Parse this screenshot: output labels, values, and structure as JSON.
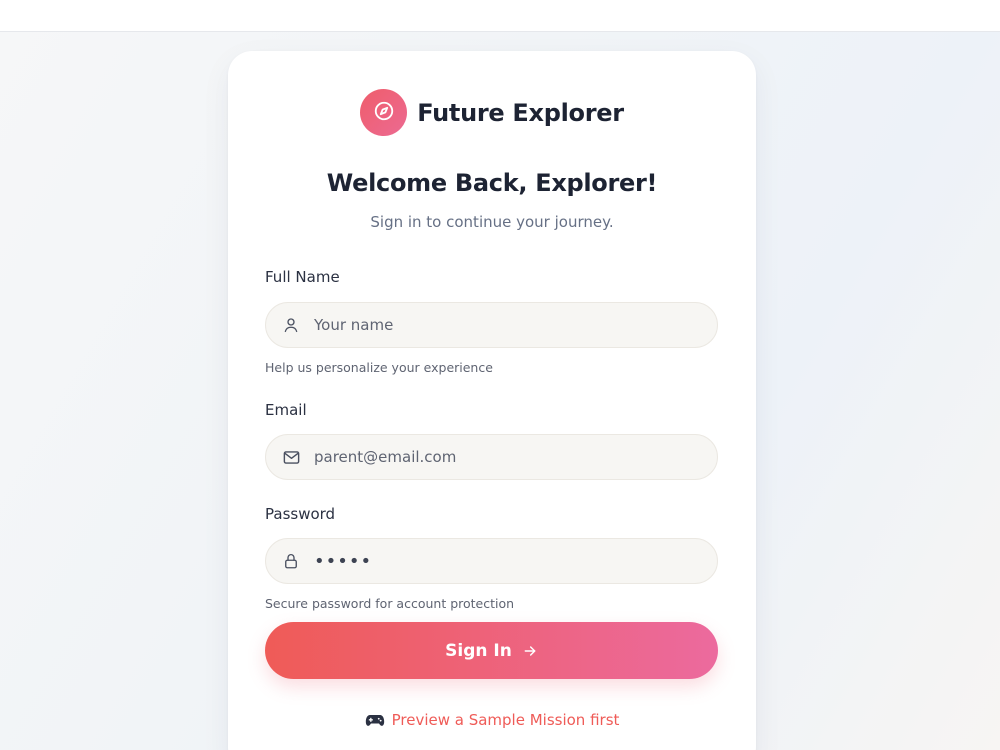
{
  "brand": {
    "name": "Future Explorer",
    "icon": "compass-icon",
    "accent_start": "#ef5d6b",
    "accent_end": "#ec6a92"
  },
  "header": {
    "title": "Welcome Back, Explorer!",
    "subtitle": "Sign in to continue your journey."
  },
  "form": {
    "full_name": {
      "label": "Full Name",
      "placeholder": "Your name",
      "value": "",
      "hint": "Help us personalize your experience",
      "icon": "user-icon"
    },
    "email": {
      "label": "Email",
      "placeholder": "parent@email.com",
      "value": "",
      "icon": "mail-icon"
    },
    "password": {
      "label": "Password",
      "value": "•••••",
      "hint": "Secure password for account protection",
      "icon": "lock-icon"
    },
    "submit_label": "Sign In",
    "submit_icon": "arrow-right-icon"
  },
  "preview_link": {
    "label": "Preview a Sample Mission first",
    "icon": "gamepad-icon",
    "color": "#ef5b57"
  }
}
